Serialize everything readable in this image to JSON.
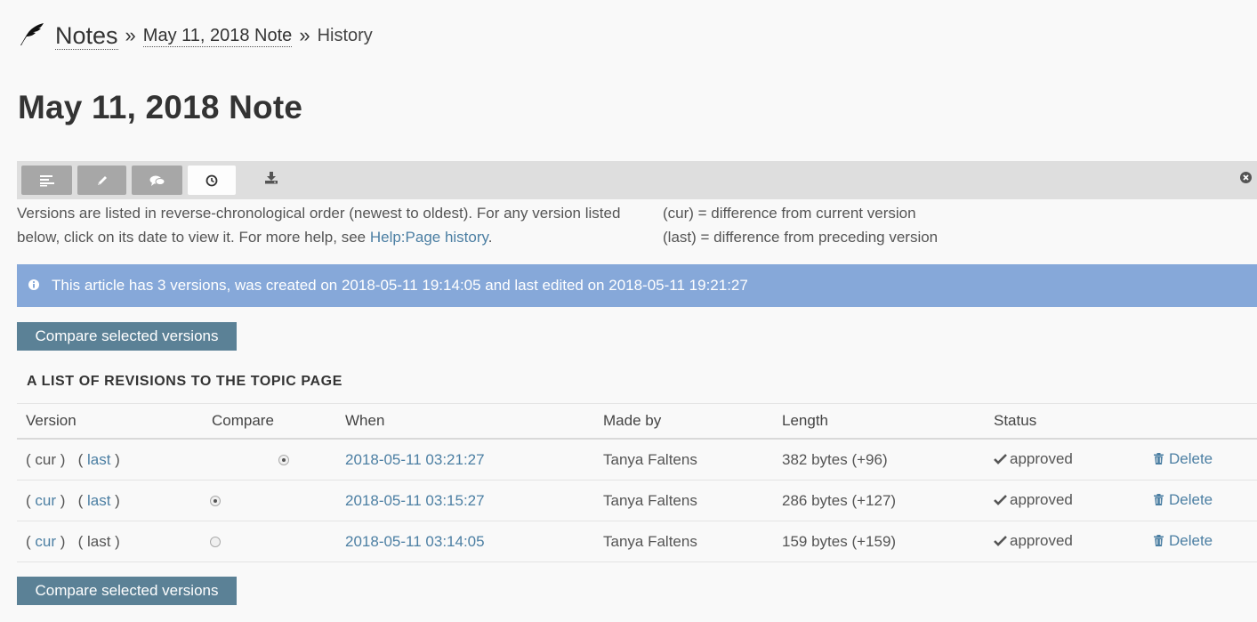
{
  "breadcrumb": {
    "root": "Notes",
    "separator": "»",
    "note": "May 11, 2018 Note",
    "current": "History"
  },
  "page_title": "May 11, 2018 Note",
  "toolbar": {
    "buttons": [
      {
        "icon": "view-icon",
        "active": false
      },
      {
        "icon": "edit-pencil-icon",
        "active": false
      },
      {
        "icon": "comments-icon",
        "active": false
      },
      {
        "icon": "history-clock-icon",
        "active": true
      }
    ],
    "extra_icon": "download-icon",
    "close_icon": "close-icon"
  },
  "intro": {
    "text_before_link": "Versions are listed in reverse-chronological order (newest to oldest). For any version listed below, click on its date to view it. For more help, see ",
    "link": "Help:Page history",
    "text_after_link": ".",
    "cur_legend": "(cur) = difference from current version",
    "last_legend": "(last) = difference from preceding version"
  },
  "alert": {
    "icon": "info-icon",
    "text": "This article has 3 versions, was created on 2018-05-11 19:14:05 and last edited on 2018-05-11 19:21:27"
  },
  "compare_button_label": "Compare selected versions",
  "table": {
    "caption": "A LIST OF REVISIONS TO THE TOPIC PAGE",
    "headers": [
      "Version",
      "Compare",
      "When",
      "Made by",
      "Length",
      "Status",
      ""
    ],
    "rows": [
      {
        "cur": "cur",
        "last": "last",
        "cur_link": false,
        "last_link": true,
        "radio": "right",
        "radio_checked": true,
        "when": "2018-05-11 03:21:27",
        "by": "Tanya Faltens",
        "length": "382 bytes (+96)",
        "status": "approved",
        "delete": "Delete"
      },
      {
        "cur": "cur",
        "last": "last",
        "cur_link": true,
        "last_link": true,
        "radio": "left",
        "radio_checked": true,
        "when": "2018-05-11 03:15:27",
        "by": "Tanya Faltens",
        "length": "286 bytes (+127)",
        "status": "approved",
        "delete": "Delete"
      },
      {
        "cur": "cur",
        "last": "last",
        "cur_link": true,
        "last_link": false,
        "radio": "left",
        "radio_checked": false,
        "when": "2018-05-11 03:14:05",
        "by": "Tanya Faltens",
        "length": "159 bytes (+159)",
        "status": "approved",
        "delete": "Delete"
      }
    ]
  },
  "colors": {
    "link": "#4c7fa3",
    "alert_bg": "#86a8d9",
    "button_bg": "#5b8196",
    "toolbar_bg": "#dedede"
  }
}
